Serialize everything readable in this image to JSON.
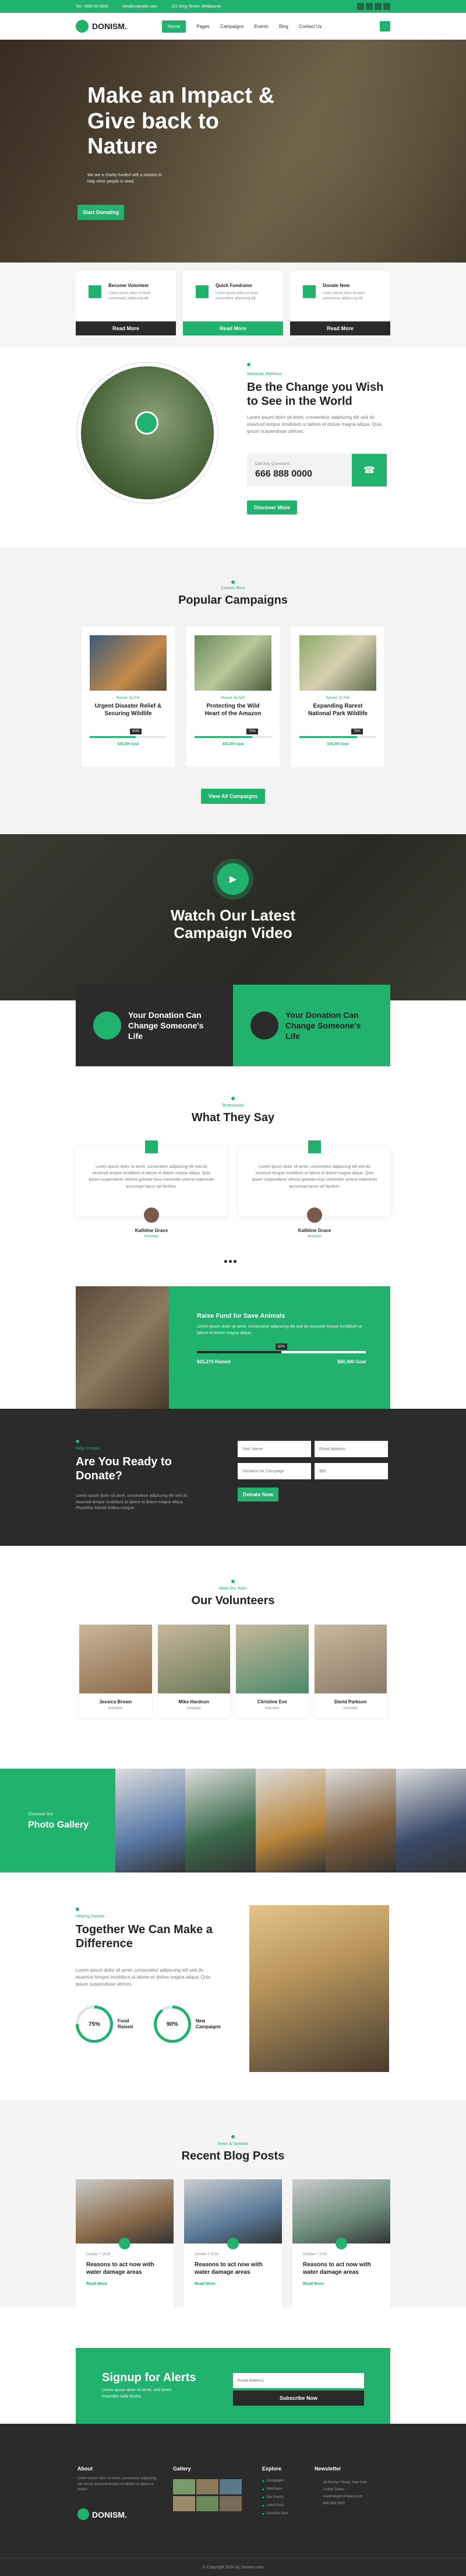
{
  "topbar": {
    "phone": "Tel: +000 00 0000",
    "email": "info@example.com",
    "address": "121 King Street, Melbourne"
  },
  "nav": {
    "logo": "DONISM.",
    "items": [
      "Home",
      "Pages",
      "Campaigns",
      "Events",
      "Blog",
      "Contact Us"
    ]
  },
  "hero": {
    "title": "Make an Impact & Give back to Nature",
    "subtitle": "We are a charity funded with a mission to help other people in need.",
    "button": "Start Donating"
  },
  "features": [
    {
      "icon": "volunteer-icon",
      "title": "Become Volunteer",
      "text": "Lorem ipsum dolor sit amet consectetur adipiscing elit.",
      "button": "Read More",
      "highlight": false
    },
    {
      "icon": "fundraise-icon",
      "title": "Quick Fundraise",
      "text": "Lorem ipsum dolor sit amet consectetur adipiscing elit.",
      "button": "Read More",
      "highlight": true
    },
    {
      "icon": "donate-icon",
      "title": "Donate Now",
      "text": "Lorem ipsum dolor sit amet consectetur adipiscing elit.",
      "button": "Read More",
      "highlight": false
    }
  ],
  "about": {
    "tag": "Welcome Wellness",
    "title": "Be the Change you Wish to See in the World",
    "text": "Lorem ipsum dolor sit amet, consectetur adipiscing elit sed do eiusmod tempor incididunt ut labore et dolore magna aliqua. Quis ipsum suspendisse ultrices.",
    "call_label": "Call Any Questions",
    "phone": "666 888 0000",
    "button": "Discover More"
  },
  "campaigns": {
    "tag": "Causes Root",
    "title": "Popular Campaigns",
    "items": [
      {
        "raised_label": "Raised: $2,500",
        "title": "Urgent Disaster Relief & Securing Wildlife",
        "progress": 0.6,
        "badge": "60%",
        "goal": "$35,000 Goal"
      },
      {
        "raised_label": "Raised: $2,500",
        "title": "Protecting the Wild Heart of the Amazon",
        "progress": 0.75,
        "badge": "75%",
        "goal": "$35,000 Goal"
      },
      {
        "raised_label": "Raised: $2,500",
        "title": "Expanding Rarest National Park Wildlife",
        "progress": 0.75,
        "badge": "75%",
        "goal": "$35,000 Goal"
      }
    ],
    "button": "View All Campaigns"
  },
  "video": {
    "title": "Watch Our Latest Campaign Video",
    "card1": "Your Donation Can Change Someone's Life",
    "card2": "Your Donation Can Change Someone's Life"
  },
  "testimonials": {
    "tag": "Testimonials",
    "title": "What They Say",
    "items": [
      {
        "text": "Lorem ipsum dolor sit amet, consectetur adipiscing elit sed do eiusmod tempor incididunt ut labore et dolore magna aliqua. Quis ipsum suspendisse ultrices gravida risus commodo viverra maecenas accumsan lacus vel facilisis.",
        "name": "Kathline Grace",
        "role": "Volunteer"
      },
      {
        "text": "Lorem ipsum dolor sit amet, consectetur adipiscing elit sed do eiusmod tempor incididunt ut labore et dolore magna aliqua. Quis ipsum suspendisse ultrices gravida risus commodo viverra maecenas accumsan lacus vel facilisis.",
        "name": "Kathline Grace",
        "role": "Volunteer"
      }
    ]
  },
  "fund": {
    "title": "Raise Fund for Save Animals",
    "text": "Lorem ipsum dolor sit amet, consectetur adipiscing elit sed do eiusmod tempor incididunt ut labore et dolore magna aliqua.",
    "raised": "$25,270 Raised",
    "goal": "$50,000 Goal",
    "progress": 0.5,
    "badge": "50%"
  },
  "donate": {
    "tag": "Help Us Now",
    "title": "Are You Ready to Donate?",
    "text": "Lorem ipsum dolor sit amet, consectetur adipiscing elit sed do eiusmod tempor incididunt ut labore et dolore magna aliqua. Phasellus blandit finibus congue.",
    "fields": [
      "Your Name",
      "Email Address",
      "Donation for Campaign",
      "$50"
    ],
    "button": "Donate Now"
  },
  "volunteers": {
    "tag": "Meet Our Team",
    "title": "Our Volunteers",
    "items": [
      {
        "name": "Jessica Brown",
        "role": "Volunteer"
      },
      {
        "name": "Mike Hardson",
        "role": "Volunteer"
      },
      {
        "name": "Christine Eve",
        "role": "Volunteer"
      },
      {
        "name": "David Parkson",
        "role": "Volunteer"
      }
    ]
  },
  "gallery": {
    "tag": "Checkout Our",
    "title": "Photo Gallery"
  },
  "difference": {
    "tag": "Helping Causes",
    "title": "Together We Can Make a Difference",
    "text": "Lorem ipsum dolor sit amet, consectetur adipiscing elit sed do eiusmod tempor incididunt ut labore et dolore magna aliqua. Quis ipsum suspendisse ultrices.",
    "stats": [
      {
        "value": "75%",
        "label": "Fund Raised",
        "pct": 0.75
      },
      {
        "value": "90%",
        "label": "New Campaigns",
        "pct": 0.9
      }
    ]
  },
  "blog": {
    "tag": "News & Updates",
    "title": "Recent Blog Posts",
    "items": [
      {
        "meta": "October 7 2024",
        "title": "Reasons to act now with water damage areas",
        "link": "Read More"
      },
      {
        "meta": "October 7 2024",
        "title": "Reasons to act now with water damage areas",
        "link": "Read More"
      },
      {
        "meta": "October 7 2024",
        "title": "Reasons to act now with water damage areas",
        "link": "Read More"
      }
    ]
  },
  "signup": {
    "title": "Signup for Alerts",
    "text": "Lorem ipsum dolor sit amet, sed lorem imperdiet nulla facilisi.",
    "placeholder": "Email Address",
    "button": "Subscribe Now"
  },
  "footer": {
    "about_title": "About",
    "about_text": "Lorem ipsum dolor sit amet, consectetur adipiscing elit sed do eiusmod tempor incididunt ut labore et dolore.",
    "logo": "DONISM.",
    "gallery_title": "Gallery",
    "explore_title": "Explore",
    "explore": [
      "Campaigns",
      "Volunteers",
      "Our Events",
      "Latest Post",
      "Donation Now"
    ],
    "news_title": "Newsletter",
    "contact": [
      "88 Broklyn Street, New York",
      "United States",
      "needhelp@company.com",
      "666 888 0000"
    ],
    "copyright": "© Copyright 2024 by Donism.com"
  },
  "colors": {
    "accent": "#21b36d",
    "dark": "#2b2b2b"
  }
}
